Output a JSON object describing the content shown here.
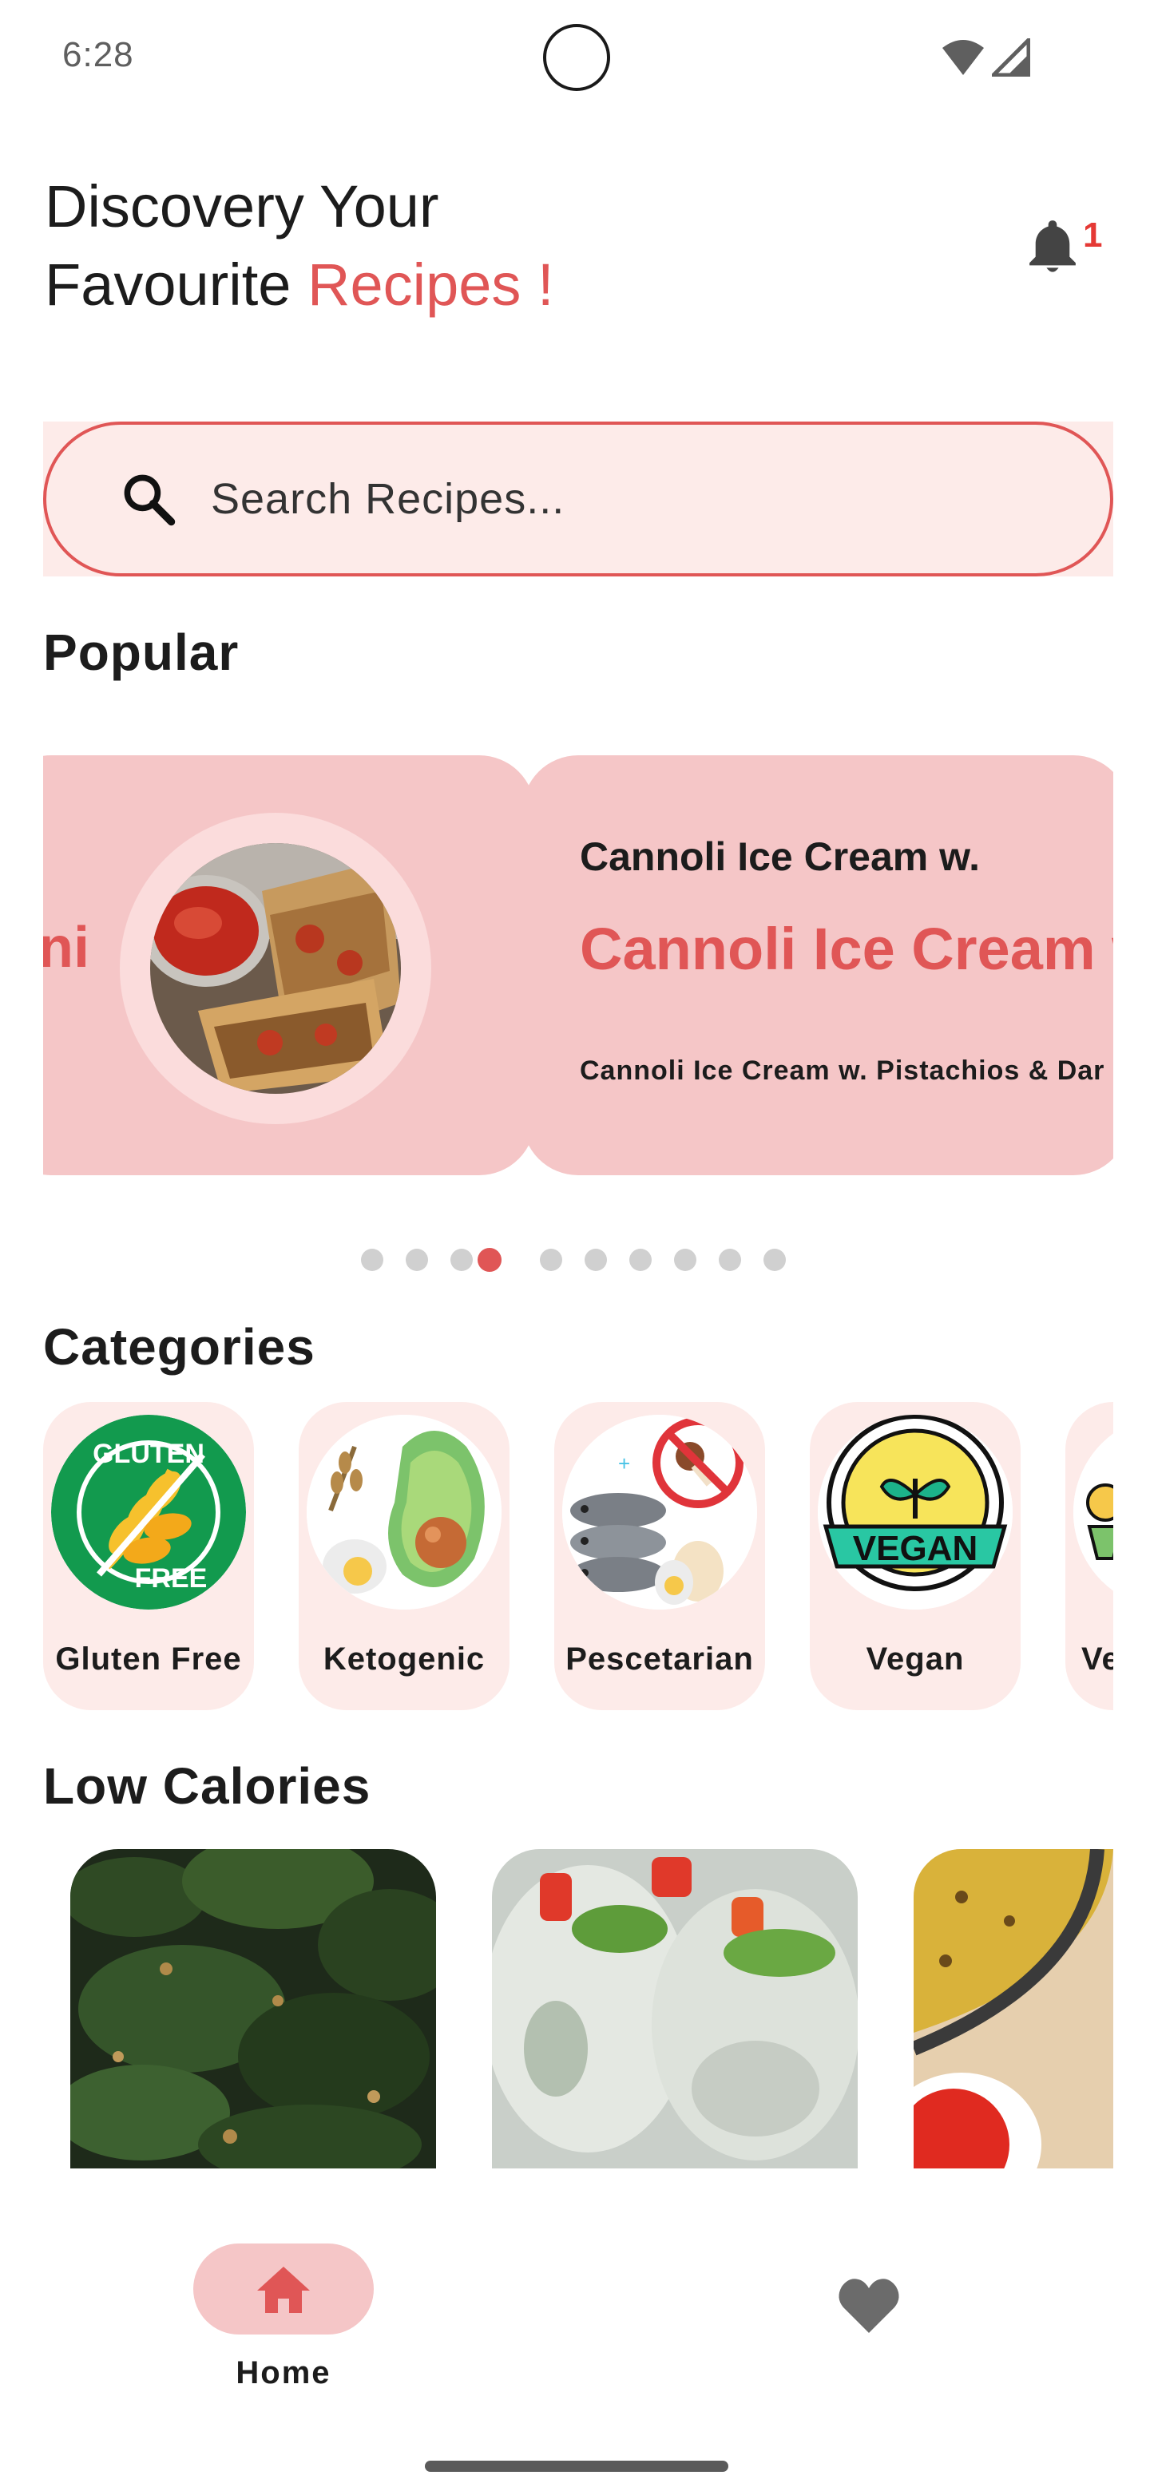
{
  "status_bar": {
    "time": "6:28"
  },
  "header": {
    "line1": "Discovery Your",
    "line2_prefix": "Favourite ",
    "line2_accent": "Recipes !",
    "notification_count": "1"
  },
  "search": {
    "placeholder": "Search Recipes..."
  },
  "sections": {
    "popular": "Popular",
    "categories": "Categories",
    "low_calories": "Low Calories"
  },
  "popular": {
    "cards": [
      {
        "partial_title": "ni"
      },
      {
        "subtitle": "Cannoli Ice Cream w.",
        "title": "Cannoli Ice Cream w",
        "description": "Cannoli Ice Cream w. Pistachios & Dar"
      }
    ],
    "page_count": 10,
    "active_page": 3
  },
  "categories": [
    {
      "label": "Gluten Free",
      "icon": "gluten-free-icon"
    },
    {
      "label": "Ketogenic",
      "icon": "ketogenic-icon"
    },
    {
      "label": "Pescetarian",
      "icon": "pescetarian-icon"
    },
    {
      "label": "Vegan",
      "icon": "vegan-icon"
    },
    {
      "label": "Ve",
      "icon": "vegetarian-icon"
    }
  ],
  "gluten_badge": {
    "top": "GLUTEN",
    "bottom": "FREE"
  },
  "vegan_badge": "VEGAN",
  "bottom_nav": {
    "home_label": "Home"
  },
  "colors": {
    "accent": "#e05656",
    "card_pink": "#f5c6c7",
    "light_pink": "#fdebe9"
  }
}
